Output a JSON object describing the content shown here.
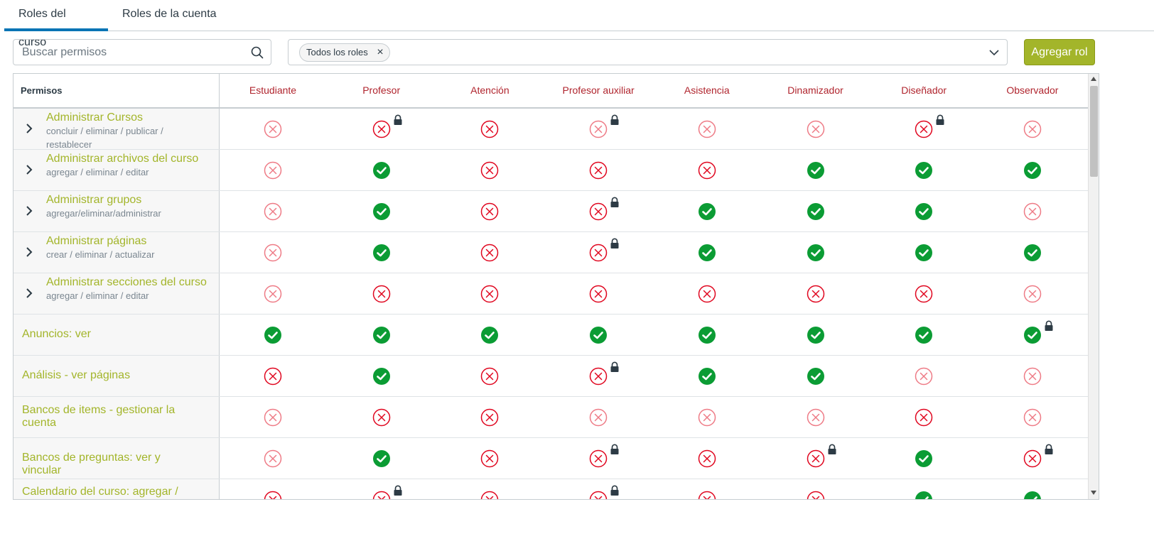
{
  "tabs": [
    {
      "label": "Roles del curso",
      "active": true
    },
    {
      "label": "Roles de la cuenta",
      "active": false
    }
  ],
  "search": {
    "placeholder": "Buscar permisos",
    "value": ""
  },
  "roles_filter": {
    "chip_label": "Todos los roles"
  },
  "add_role_label": "Agregar rol",
  "colors": {
    "accent": "#0374b5",
    "brand": "#a3b52a",
    "role_header": "#b0252e",
    "granted": "#0b9c34",
    "denied": "#e0061f",
    "denied_light": "#ee7b86"
  },
  "table": {
    "first_column_header": "Permisos",
    "roles": [
      "Estudiante",
      "Profesor",
      "Atención",
      "Profesor auxiliar",
      "Asistencia",
      "Dinamizador",
      "Diseñador",
      "Observador"
    ],
    "rows": [
      {
        "title": "Administrar Cursos",
        "desc": "concluir / eliminar / publicar / restablecer",
        "expandable": true,
        "cells": [
          {
            "s": "off"
          },
          {
            "s": "deny",
            "lock": true
          },
          {
            "s": "deny"
          },
          {
            "s": "off",
            "lock": true
          },
          {
            "s": "off"
          },
          {
            "s": "off"
          },
          {
            "s": "deny",
            "lock": true
          },
          {
            "s": "off"
          }
        ]
      },
      {
        "title": "Administrar archivos del curso",
        "desc": "agregar / eliminar / editar",
        "expandable": true,
        "cells": [
          {
            "s": "off"
          },
          {
            "s": "on"
          },
          {
            "s": "deny"
          },
          {
            "s": "deny"
          },
          {
            "s": "deny"
          },
          {
            "s": "on"
          },
          {
            "s": "on"
          },
          {
            "s": "on"
          }
        ]
      },
      {
        "title": "Administrar grupos",
        "desc": "agregar/eliminar/administrar",
        "expandable": true,
        "cells": [
          {
            "s": "off"
          },
          {
            "s": "on"
          },
          {
            "s": "deny"
          },
          {
            "s": "deny",
            "lock": true
          },
          {
            "s": "on"
          },
          {
            "s": "on"
          },
          {
            "s": "on"
          },
          {
            "s": "off"
          }
        ]
      },
      {
        "title": "Administrar páginas",
        "desc": "crear / eliminar / actualizar",
        "expandable": true,
        "cells": [
          {
            "s": "off"
          },
          {
            "s": "on"
          },
          {
            "s": "deny"
          },
          {
            "s": "deny",
            "lock": true
          },
          {
            "s": "on"
          },
          {
            "s": "on"
          },
          {
            "s": "on"
          },
          {
            "s": "on"
          }
        ]
      },
      {
        "title": "Administrar secciones del curso",
        "desc": "agregar / eliminar / editar",
        "expandable": true,
        "cells": [
          {
            "s": "off"
          },
          {
            "s": "deny"
          },
          {
            "s": "deny"
          },
          {
            "s": "deny"
          },
          {
            "s": "deny"
          },
          {
            "s": "deny"
          },
          {
            "s": "deny"
          },
          {
            "s": "off"
          }
        ]
      },
      {
        "title": "Anuncios: ver",
        "desc": "",
        "expandable": false,
        "cells": [
          {
            "s": "on"
          },
          {
            "s": "on"
          },
          {
            "s": "on"
          },
          {
            "s": "on"
          },
          {
            "s": "on"
          },
          {
            "s": "on"
          },
          {
            "s": "on"
          },
          {
            "s": "on",
            "lock": true
          }
        ]
      },
      {
        "title": "Análisis - ver páginas",
        "desc": "",
        "expandable": false,
        "cells": [
          {
            "s": "deny"
          },
          {
            "s": "on"
          },
          {
            "s": "deny"
          },
          {
            "s": "deny",
            "lock": true
          },
          {
            "s": "on"
          },
          {
            "s": "on"
          },
          {
            "s": "off"
          },
          {
            "s": "off"
          }
        ]
      },
      {
        "title": "Bancos de items - gestionar la cuenta",
        "desc": "",
        "expandable": false,
        "cells": [
          {
            "s": "off"
          },
          {
            "s": "deny"
          },
          {
            "s": "deny"
          },
          {
            "s": "off"
          },
          {
            "s": "off"
          },
          {
            "s": "off"
          },
          {
            "s": "deny"
          },
          {
            "s": "off"
          }
        ]
      },
      {
        "title": "Bancos de preguntas: ver y vincular",
        "desc": "",
        "expandable": false,
        "cells": [
          {
            "s": "off"
          },
          {
            "s": "on"
          },
          {
            "s": "deny"
          },
          {
            "s": "deny",
            "lock": true
          },
          {
            "s": "deny"
          },
          {
            "s": "deny",
            "lock": true
          },
          {
            "s": "on"
          },
          {
            "s": "deny",
            "lock": true
          }
        ]
      },
      {
        "title": "Calendario del curso: agregar /",
        "desc": "",
        "expandable": false,
        "cells": [
          {
            "s": "deny"
          },
          {
            "s": "deny",
            "lock": true
          },
          {
            "s": "deny"
          },
          {
            "s": "deny",
            "lock": true
          },
          {
            "s": "deny"
          },
          {
            "s": "deny"
          },
          {
            "s": "on"
          },
          {
            "s": "on"
          }
        ]
      }
    ]
  }
}
